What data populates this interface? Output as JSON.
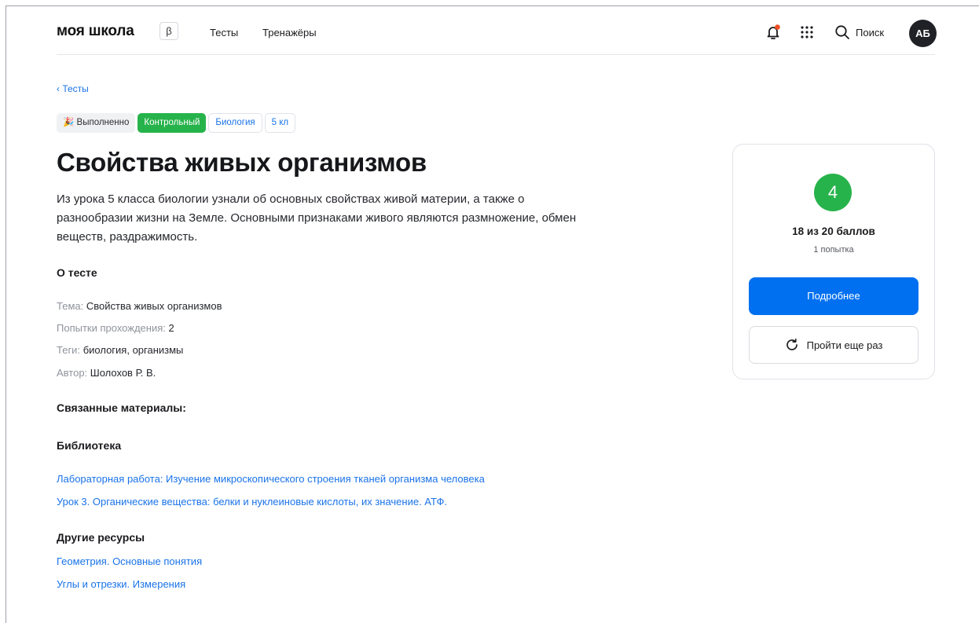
{
  "header": {
    "logo": "моя школа",
    "beta": "β",
    "nav": [
      {
        "label": "Тесты"
      },
      {
        "label": "Тренажёры"
      }
    ],
    "search_label": "Поиск",
    "avatar_initials": "АБ",
    "notification_dot_color": "#f04e23"
  },
  "breadcrumb": {
    "back_label": "‹ Тесты"
  },
  "tags": {
    "done": "Выполненно",
    "done_icon": "party-popper-icon",
    "control": "Контрольный",
    "subject": "Биология",
    "grade": "5 кл"
  },
  "page": {
    "title": "Свойства живых организмов",
    "description": "Из урока 5 класса биологии узнали об основных свойствах живой материи, а также о разнообразии жизни на Земле. Основными признаками живого являются размножение, обмен веществ, раздражимость."
  },
  "about": {
    "heading": "О тесте",
    "rows": [
      {
        "key": "Тема:",
        "value": "Свойства живых организмов"
      },
      {
        "key": "Попытки прохождения:",
        "value": "2"
      },
      {
        "key": "Теги:",
        "value": "биология, организмы"
      },
      {
        "key": "Автор:",
        "value": "Шолохов Р. В."
      }
    ]
  },
  "related": {
    "heading": "Связанные материалы:",
    "library_heading": "Библиотека",
    "library_links": [
      "Лабораторная работа: Изучение микроскопического строения тканей организма человека",
      "Урок 3. Органические вещества: белки и нуклеиновые кислоты, их значение. АТФ."
    ],
    "other_heading": "Другие ресурсы",
    "other_links": [
      "Геометрия. Основные понятия",
      "Углы и отрезки. Измерения"
    ]
  },
  "result_card": {
    "grade": "4",
    "score": "18 из 20 баллов",
    "attempts": "1 попытка",
    "details_button": "Подробнее",
    "retry_button": "Пройти еще раз",
    "accent_color": "#0070f0",
    "grade_color": "#27b34b"
  }
}
